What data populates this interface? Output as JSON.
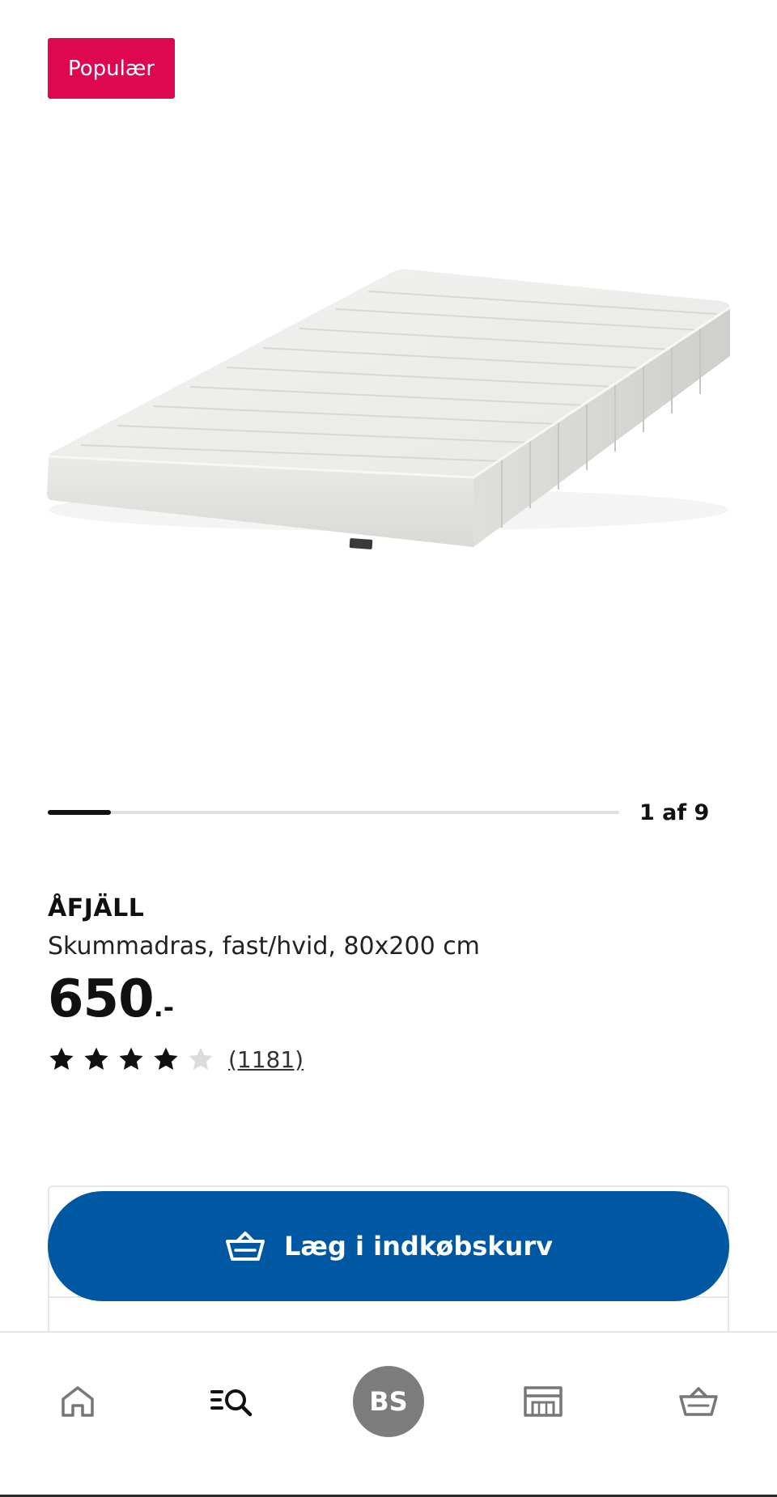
{
  "badge": {
    "label": "Populær",
    "color": "#e00751"
  },
  "product": {
    "image_alt": "ÅFJÄLL mattress",
    "name": "ÅFJÄLL",
    "description": "Skummadras, fast/hvid, 80x200 cm",
    "price": "650",
    "price_suffix": ".-",
    "rating_value": 4,
    "rating_max": 5,
    "review_count": "(1181)"
  },
  "carousel": {
    "counter": "1 af 9",
    "current": 1,
    "total": 9,
    "progress_fraction": 0.11
  },
  "add_to_cart": {
    "label": "Læg i indkøbskurv",
    "icon": "cart-icon",
    "color": "#0058a3"
  },
  "bottom_nav": {
    "items": [
      {
        "name": "home",
        "icon": "home-icon"
      },
      {
        "name": "search",
        "icon": "search-list-icon"
      },
      {
        "name": "profile",
        "avatar_initials": "BS"
      },
      {
        "name": "store",
        "icon": "store-icon"
      },
      {
        "name": "cart",
        "icon": "cart-icon"
      }
    ]
  }
}
